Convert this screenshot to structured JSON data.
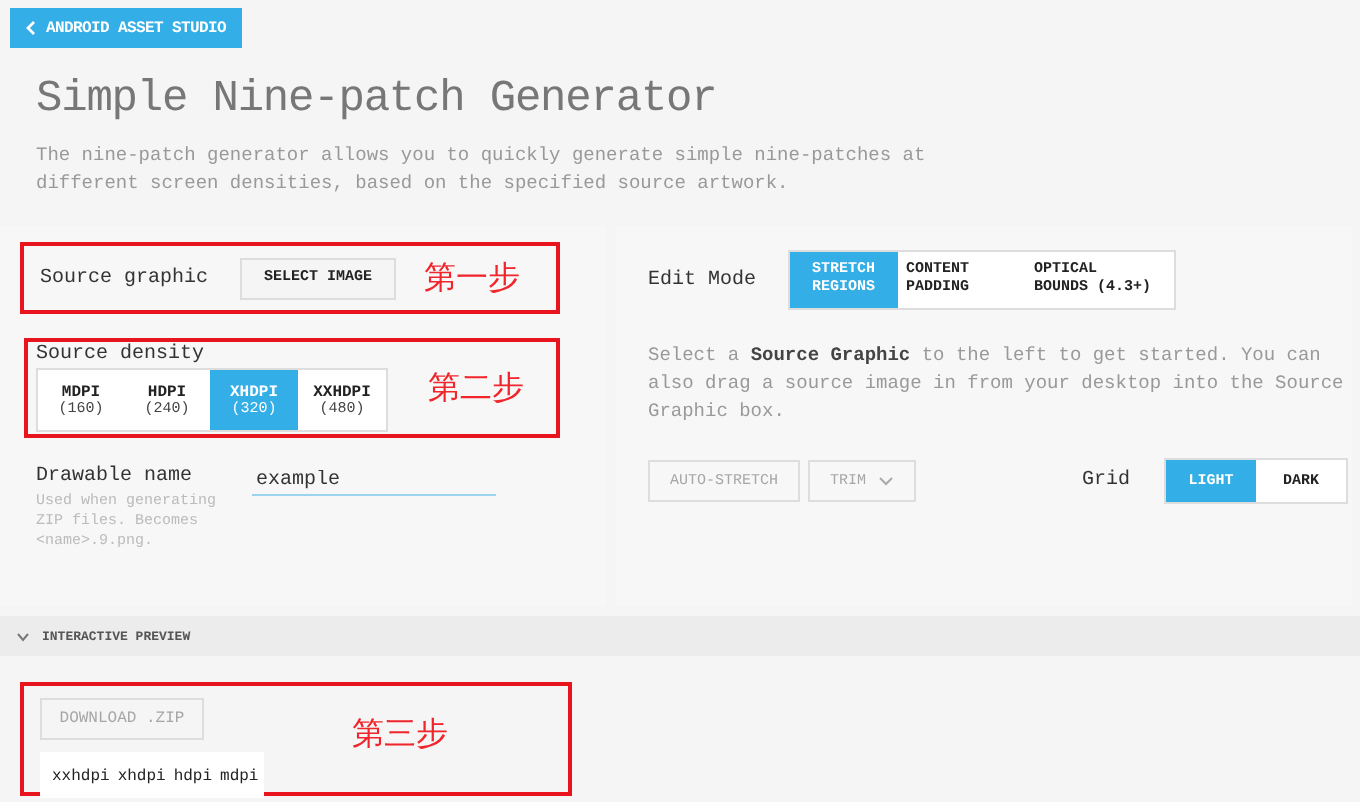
{
  "back_button": {
    "label": "ANDROID ASSET STUDIO"
  },
  "title": "Simple Nine-patch Generator",
  "description": "The nine-patch generator allows you to quickly generate simple nine-patches at different screen densities, based on the specified source artwork.",
  "source_graphic": {
    "label": "Source graphic",
    "button": "SELECT IMAGE",
    "annotation": "第一步"
  },
  "source_density": {
    "label": "Source density",
    "annotation": "第二步",
    "options": [
      {
        "name": "MDPI",
        "dpi": "(160)",
        "selected": false
      },
      {
        "name": "HDPI",
        "dpi": "(240)",
        "selected": false
      },
      {
        "name": "XHDPI",
        "dpi": "(320)",
        "selected": true
      },
      {
        "name": "XXHDPI",
        "dpi": "(480)",
        "selected": false
      }
    ]
  },
  "drawable_name": {
    "label": "Drawable name",
    "hint": "Used when generating ZIP files. Becomes <name>.9.png.",
    "value": "example"
  },
  "edit_mode": {
    "label": "Edit Mode",
    "options": [
      {
        "label": "STRETCH REGIONS",
        "selected": true
      },
      {
        "label": "CONTENT PADDING",
        "selected": false
      },
      {
        "label": "OPTICAL BOUNDS (4.3+)",
        "selected": false
      }
    ]
  },
  "instructions": "Select a **Source Graphic** to the left to get started. You can also drag a source image in from your desktop into the Source Graphic box.",
  "actions": [
    {
      "kind": "button",
      "label": "AUTO-STRETCH",
      "disabled": true
    },
    {
      "kind": "dropdown",
      "label": "TRIM",
      "disabled": true
    }
  ],
  "grid": {
    "label": "Grid",
    "options": [
      {
        "label": "LIGHT",
        "selected": true
      },
      {
        "label": "DARK",
        "selected": false
      }
    ]
  },
  "preview": {
    "title": "INTERACTIVE PREVIEW",
    "expanded": true,
    "annotation": "第三步",
    "download_button": {
      "label": "DOWNLOAD .ZIP",
      "disabled": true
    },
    "densities": [
      "xxhdpi",
      "xhdpi",
      "hdpi",
      "mdpi"
    ]
  }
}
